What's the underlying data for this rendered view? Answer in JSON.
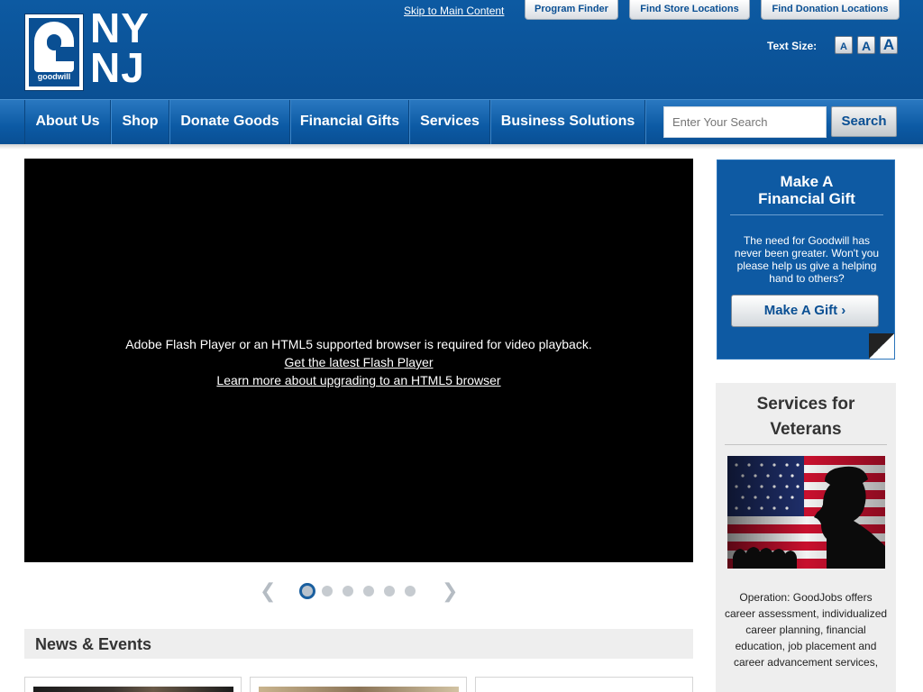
{
  "header": {
    "logo_word": "goodwill",
    "logo_line1": "NY",
    "logo_line2": "NJ",
    "skip_link": "Skip to Main Content",
    "buttons": {
      "program_finder": "Program Finder",
      "store_locations": "Find Store Locations",
      "donation_locations": "Find Donation Locations"
    },
    "text_size_label": "Text Size:",
    "text_size_small": "A",
    "text_size_medium": "A",
    "text_size_large": "A"
  },
  "nav": {
    "items": [
      "About Us",
      "Shop",
      "Donate Goods",
      "Financial Gifts",
      "Services",
      "Business Solutions"
    ],
    "search_placeholder": "Enter Your Search",
    "search_button": "Search"
  },
  "video": {
    "message": "Adobe Flash Player or an HTML5 supported browser is required for video playback.",
    "flash_link": "Get the latest Flash Player",
    "html5_link": "Learn more about upgrading to an HTML5 browser"
  },
  "slider": {
    "slide_count": 6,
    "active_slide": 1
  },
  "news": {
    "title": "News & Events"
  },
  "gift": {
    "title_line1": "Make A",
    "title_line2": "Financial Gift",
    "text": "The need for Goodwill has never been greater. Won't you please help us give a helping hand to others?",
    "button": "Make A Gift ›"
  },
  "veterans": {
    "title_line1": "Services for",
    "title_line2": "Veterans",
    "text": "Operation: GoodJobs offers career assessment, individualized career planning, financial education, job placement and career advancement services,"
  },
  "colors": {
    "brand_blue": "#0a4f93",
    "nav_blue": "#0c5aa4",
    "panel_gray": "#eeeeee"
  }
}
